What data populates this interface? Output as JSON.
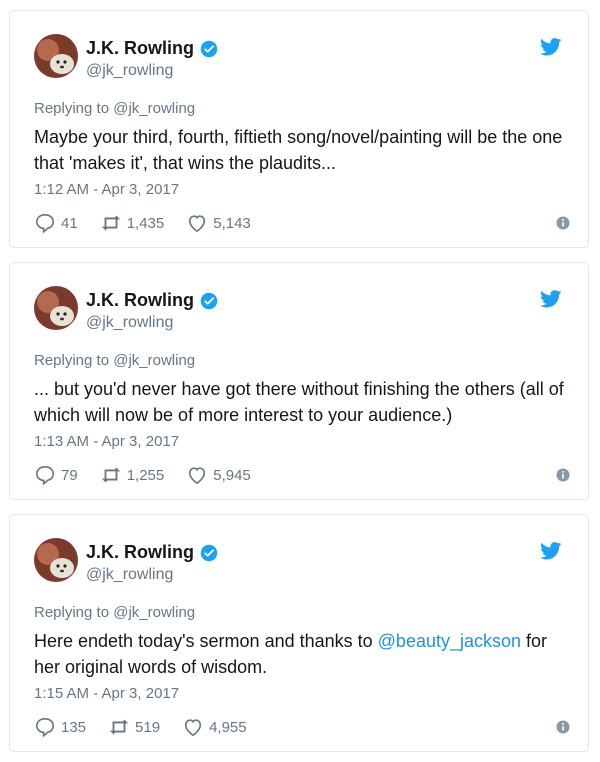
{
  "colors": {
    "accent": "#1b95e0",
    "muted": "#657786",
    "text": "#14171a"
  },
  "tweets": [
    {
      "name": "J.K. Rowling",
      "handle": "@jk_rowling",
      "replying": "Replying to @jk_rowling",
      "text_before": "Maybe your third, fourth, fiftieth song/novel/painting will be the one that 'makes it', that wins the plaudits...",
      "mention": "",
      "text_after": "",
      "time": "1:12 AM - Apr 3, 2017",
      "replies": "41",
      "retweets": "1,435",
      "likes": "5,143"
    },
    {
      "name": "J.K. Rowling",
      "handle": "@jk_rowling",
      "replying": "Replying to @jk_rowling",
      "text_before": "... but you'd never have got there without finishing the others (all of which will now be of more interest to your audience.)",
      "mention": "",
      "text_after": "",
      "time": "1:13 AM - Apr 3, 2017",
      "replies": "79",
      "retweets": "1,255",
      "likes": "5,945"
    },
    {
      "name": "J.K. Rowling",
      "handle": "@jk_rowling",
      "replying": "Replying to @jk_rowling",
      "text_before": "Here endeth today's sermon and thanks to ",
      "mention": "@beauty_jackson",
      "text_after": " for her original words of wisdom.",
      "time": "1:15 AM - Apr 3, 2017",
      "replies": "135",
      "retweets": "519",
      "likes": "4,955"
    }
  ]
}
